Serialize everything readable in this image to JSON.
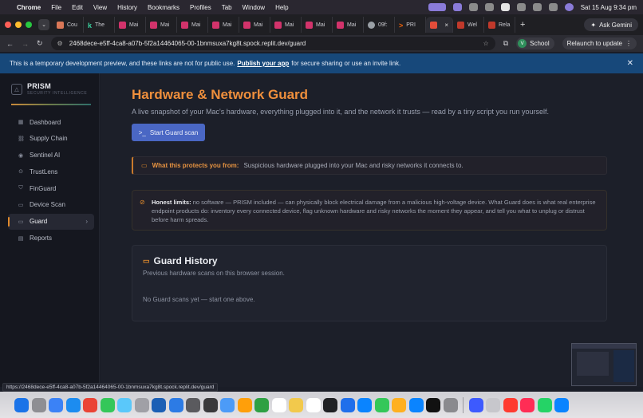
{
  "menubar": {
    "app": "Chrome",
    "items": [
      "File",
      "Edit",
      "View",
      "History",
      "Bookmarks",
      "Profiles",
      "Tab",
      "Window",
      "Help"
    ],
    "datetime": "Sat 15 Aug  9:34 pm"
  },
  "tabs": [
    {
      "label": "Cou",
      "icon": "claude-icon"
    },
    {
      "label": "The",
      "icon": "k-icon"
    },
    {
      "label": "Mai",
      "icon": "mail-icon"
    },
    {
      "label": "Mai",
      "icon": "mail-icon"
    },
    {
      "label": "Mai",
      "icon": "mail-icon"
    },
    {
      "label": "Mai",
      "icon": "mail-icon"
    },
    {
      "label": "Mai",
      "icon": "mail-icon"
    },
    {
      "label": "Mai",
      "icon": "mail-icon"
    },
    {
      "label": "Mai",
      "icon": "mail-icon"
    },
    {
      "label": "Mai",
      "icon": "mail-icon"
    },
    {
      "label": "09f:",
      "icon": "globe-icon"
    },
    {
      "label": "PRI",
      "icon": "replit-icon"
    }
  ],
  "active_tab": {
    "close": "×"
  },
  "tabs_after": [
    {
      "label": "Wel",
      "icon": "red-icon"
    },
    {
      "label": "Rela",
      "icon": "red-icon"
    }
  ],
  "gemini_label": "Ask Gemini",
  "url": "2468dece-e5ff-4ca8-a07b-5f2a14464065-00-1bnmsuxa7kg8t.spock.replit.dev/guard",
  "profile": {
    "initial": "V",
    "name": "School"
  },
  "relaunch_label": "Relaunch to update",
  "banner": {
    "text_before": "This is a temporary development preview, and these links are not for public use.",
    "link": "Publish your app",
    "text_after": "for secure sharing or use an invite link."
  },
  "brand": {
    "name": "PRISM",
    "tagline": "SECURITY INTELLIGENCE"
  },
  "nav": [
    {
      "label": "Dashboard",
      "icon": "grid-icon"
    },
    {
      "label": "Supply Chain",
      "icon": "chain-icon"
    },
    {
      "label": "Sentinel AI",
      "icon": "eye-icon"
    },
    {
      "label": "TrustLens",
      "icon": "lens-icon"
    },
    {
      "label": "FinGuard",
      "icon": "shield-icon"
    },
    {
      "label": "Device Scan",
      "icon": "device-icon"
    },
    {
      "label": "Guard",
      "icon": "guard-icon"
    },
    {
      "label": "Reports",
      "icon": "report-icon"
    }
  ],
  "page": {
    "title": "Hardware & Network Guard",
    "subtitle": "A live snapshot of your Mac's hardware, everything plugged into it, and the network it trusts — read by a tiny script you run yourself.",
    "scan_button": "Start Guard scan",
    "protects_label": "What this protects you from:",
    "protects_text": "Suspicious hardware plugged into your Mac and risky networks it connects to.",
    "honest_label": "Honest limits:",
    "honest_text": "no software — PRISM included — can physically block electrical damage from a malicious high-voltage device. What Guard does is what real enterprise endpoint products do: inventory every connected device, flag unknown hardware and risky networks the moment they appear, and tell you what to unplug or distrust before harm spreads.",
    "history_title": "Guard History",
    "history_sub": "Previous hardware scans on this browser session.",
    "history_empty": "No Guard scans yet — start one above."
  },
  "status_url": "https://2468dece-e5ff-4ca8-a07b-5f2a14464065-00-1bnmsuxa7kg8t.spock.replit.dev/guard",
  "dock_colors": [
    "#1a73e8",
    "#8e8e93",
    "#3b82f6",
    "#1c8cf0",
    "#ea4335",
    "#34c759",
    "#5ac8fa",
    "#a0a0a6",
    "#1b5fb5",
    "#2c7be5",
    "#5a5a5e",
    "#3a3a3c",
    "#4c9bf7",
    "#ff9f0a",
    "#2ea043",
    "#ffffff",
    "#f2c94c",
    "#ffffff",
    "#202124",
    "#1f6feb",
    "#0a84ff",
    "#34c759",
    "#ffb020",
    "#0a84ff",
    "#111111",
    "#8a8a8e",
    "#3d5afe",
    "#c7c7cc",
    "#ff3b30",
    "#ff2d55",
    "#25d366",
    "#0a84ff"
  ]
}
